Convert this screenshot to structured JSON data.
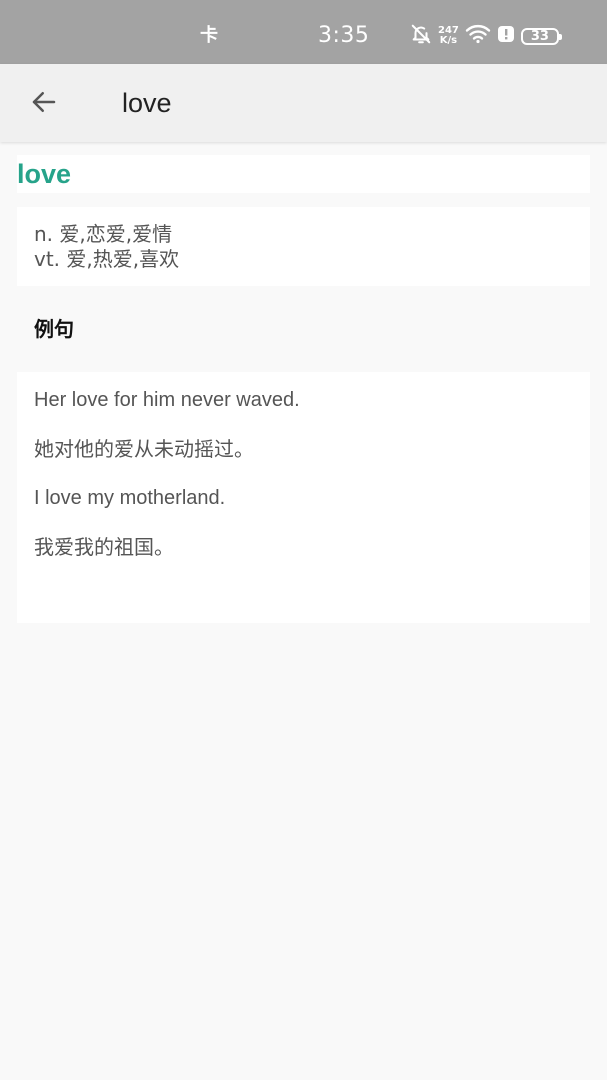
{
  "status_bar": {
    "sim_label": "卡",
    "time": "3:35",
    "net_speed_value": "247",
    "net_speed_unit": "K/s",
    "battery": "33",
    "icons": [
      "bell-off-icon",
      "wifi-icon",
      "alert-icon",
      "battery-icon"
    ]
  },
  "app_bar": {
    "back_icon": "arrow-left-icon",
    "title": "love"
  },
  "word": {
    "headword": "love",
    "definitions": [
      "n. 爱,恋爱,爱情",
      "vt. 爱,热爱,喜欢"
    ]
  },
  "examples": {
    "section_title": "例句",
    "items": [
      {
        "en": "Her love for him never waved.",
        "zh": "她对他的爱从未动摇过。"
      },
      {
        "en": "I love my motherland.",
        "zh": "我爱我的祖国。"
      }
    ]
  },
  "colors": {
    "accent": "#26a38a",
    "status_bar": "#a3a3a3",
    "app_bar": "#f0f0f0",
    "background": "#f9f9f9",
    "card": "#ffffff",
    "text_secondary": "#555555"
  }
}
